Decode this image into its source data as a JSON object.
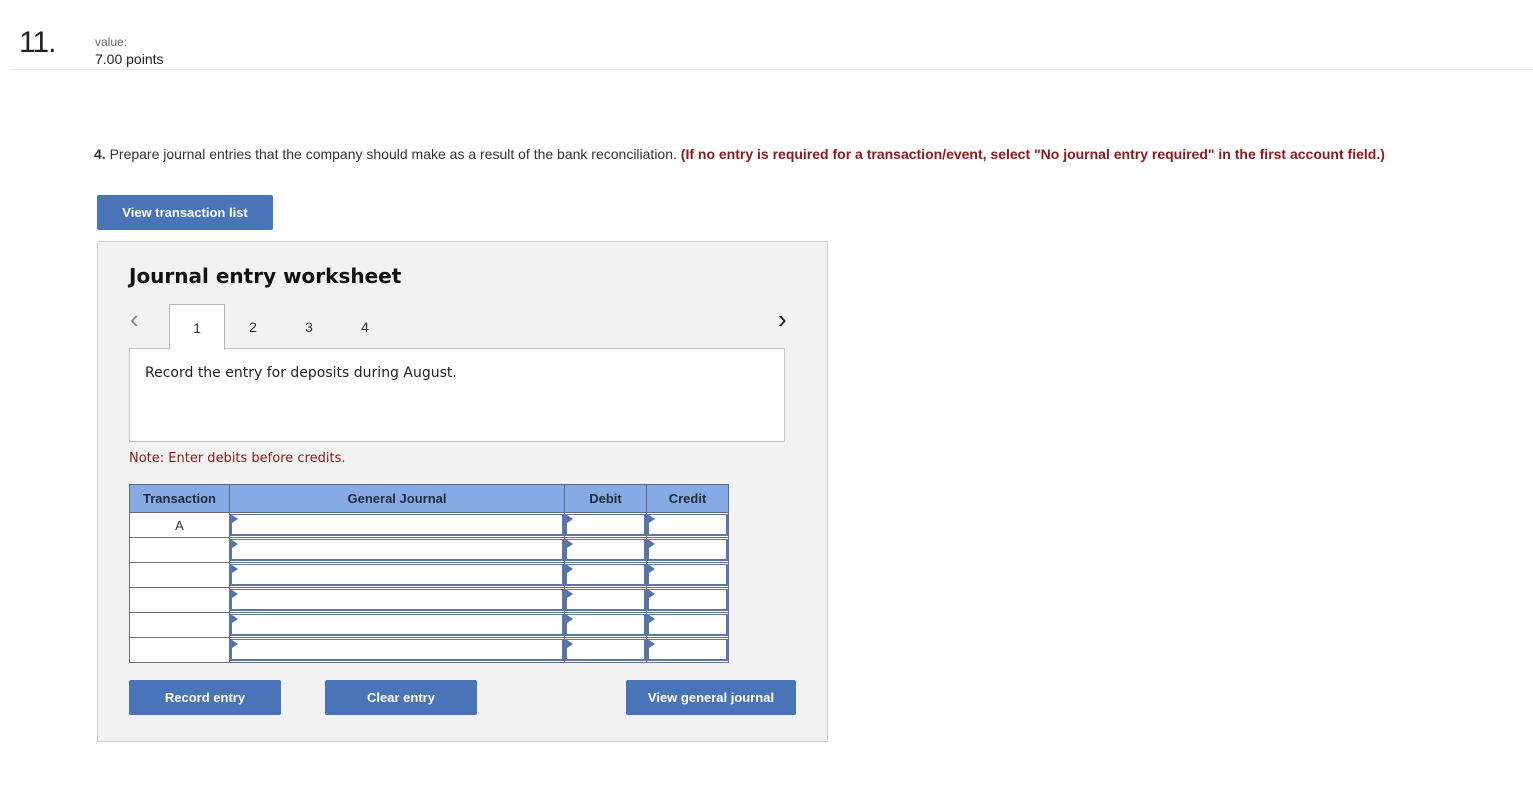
{
  "question": {
    "number": "11.",
    "value_label": "value:",
    "value": "7.00 points"
  },
  "instruction": {
    "part_number": "4.",
    "text": " Prepare journal entries that the company should make as a result of the bank reconciliation. ",
    "emphasis": "(If no entry is required for a transaction/event, select \"No journal entry required\" in the first account field.)"
  },
  "buttons": {
    "view_transaction_list": "View transaction list",
    "record_entry": "Record entry",
    "clear_entry": "Clear entry",
    "view_general_journal": "View general journal"
  },
  "worksheet": {
    "title": "Journal entry worksheet",
    "prev_icon": "‹",
    "next_icon": "›",
    "tabs": [
      {
        "label": "1",
        "active": true
      },
      {
        "label": "2",
        "active": false
      },
      {
        "label": "3",
        "active": false
      },
      {
        "label": "4",
        "active": false
      }
    ],
    "description": "Record the entry for deposits during August.",
    "note": "Note: Enter debits before credits."
  },
  "journal_table": {
    "headers": [
      "Transaction",
      "General Journal",
      "Debit",
      "Credit"
    ],
    "rows": [
      {
        "transaction": "A",
        "account": "",
        "debit": "",
        "credit": ""
      },
      {
        "transaction": "",
        "account": "",
        "debit": "",
        "credit": ""
      },
      {
        "transaction": "",
        "account": "",
        "debit": "",
        "credit": ""
      },
      {
        "transaction": "",
        "account": "",
        "debit": "",
        "credit": ""
      },
      {
        "transaction": "",
        "account": "",
        "debit": "",
        "credit": ""
      },
      {
        "transaction": "",
        "account": "",
        "debit": "",
        "credit": ""
      }
    ]
  },
  "colors": {
    "button_blue": "#4a74b8",
    "header_blue": "#86aae4",
    "emphasis_red": "#8b1a1a",
    "panel_gray": "#f2f2f2"
  }
}
